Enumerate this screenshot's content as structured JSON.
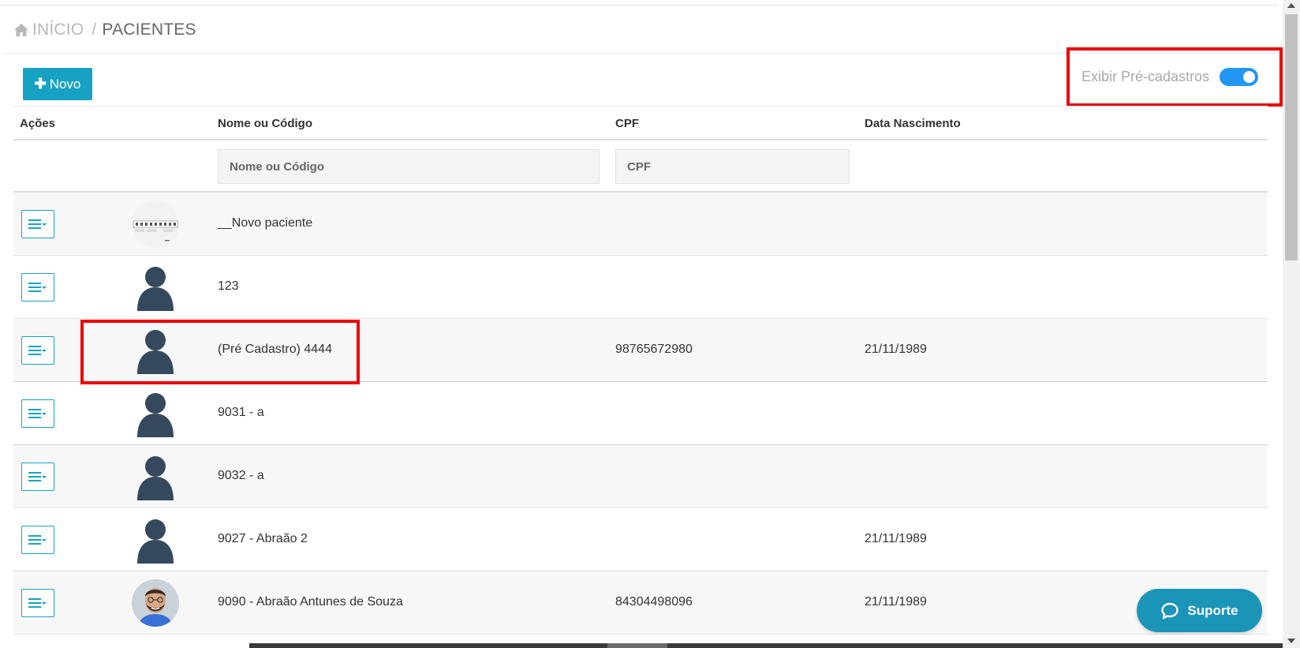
{
  "breadcrumb": {
    "home_icon": "home-icon",
    "home": "INÍCIO",
    "separator": "/",
    "current": "PACIENTES"
  },
  "toolbar": {
    "new_label": "Novo",
    "new_icon": "plus-icon",
    "toggle_label": "Exibir Pré-cadastros",
    "toggle_on": true
  },
  "table": {
    "headers": {
      "actions": "Ações",
      "name": "Nome ou Código",
      "cpf": "CPF",
      "birth": "Data Nascimento"
    },
    "filters": {
      "name_placeholder": "Nome ou Código",
      "cpf_placeholder": "CPF"
    },
    "rows": [
      {
        "name": "__Novo paciente",
        "cpf": "",
        "birth": "",
        "avatar": "thumbnail-image"
      },
      {
        "name": "123",
        "cpf": "",
        "birth": "",
        "avatar": "person-silhouette-icon"
      },
      {
        "name": "(Pré Cadastro) 4444",
        "cpf": "98765672980",
        "birth": "21/11/1989",
        "avatar": "person-silhouette-icon"
      },
      {
        "name": "9031 - a",
        "cpf": "",
        "birth": "",
        "avatar": "person-silhouette-icon"
      },
      {
        "name": "9032 - a",
        "cpf": "",
        "birth": "",
        "avatar": "person-silhouette-icon"
      },
      {
        "name": "9027 - Abraão 2",
        "cpf": "",
        "birth": "21/11/1989",
        "avatar": "person-silhouette-icon"
      },
      {
        "name": "9090 - Abraão Antunes de Souza",
        "cpf": "84304498096",
        "birth": "21/11/1989",
        "avatar": "photo"
      }
    ]
  },
  "support": {
    "label": "Suporte",
    "icon": "chat-bubble-icon"
  },
  "colors": {
    "accent": "#17a2c4",
    "toggle": "#2196f3",
    "highlight": "#ee0000",
    "avatar": "#34495e",
    "support": "#1b95b7"
  }
}
